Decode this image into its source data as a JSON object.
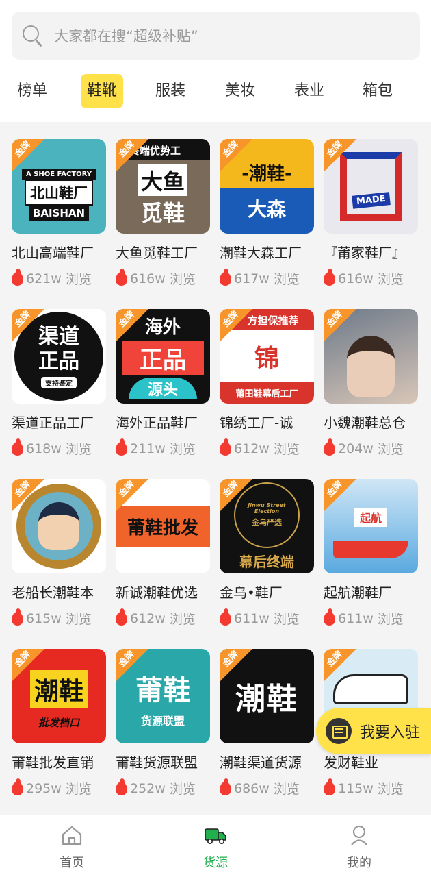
{
  "search": {
    "placeholder": "大家都在搜“超级补贴”"
  },
  "tabs": [
    "榜单",
    "鞋靴",
    "服装",
    "美妆",
    "表业",
    "箱包"
  ],
  "active_tab": "鞋靴",
  "badge_label": "金牌",
  "views_unit": "浏览",
  "items": [
    {
      "name": "北山高端鞋厂",
      "views": "621w",
      "thumb": [
        "A SHOE FACTORY",
        "北山鞋厂",
        "BAISHAN"
      ]
    },
    {
      "name": "大鱼觅鞋工厂",
      "views": "616w",
      "thumb": [
        "终端优势工",
        "大鱼",
        "觅鞋"
      ]
    },
    {
      "name": "潮鞋大森工厂",
      "views": "617w",
      "thumb": [
        "-潮鞋-",
        "大森"
      ]
    },
    {
      "name": "『莆家鞋厂』",
      "views": "616w",
      "thumb": [
        "MADE"
      ]
    },
    {
      "name": "渠道正品工厂",
      "views": "618w",
      "thumb": [
        "渠道",
        "正品",
        "支持鉴定"
      ]
    },
    {
      "name": "海外正品鞋厂",
      "views": "211w",
      "thumb": [
        "海外",
        "正品",
        "源头"
      ]
    },
    {
      "name": "锦绣工厂-诚",
      "views": "612w",
      "thumb": [
        "方担保推荐",
        "锦",
        "莆田鞋幕后工厂"
      ]
    },
    {
      "name": "小魏潮鞋总仓",
      "views": "204w",
      "thumb": []
    },
    {
      "name": "老船长潮鞋本",
      "views": "615w",
      "thumb": []
    },
    {
      "name": "新诚潮鞋优选",
      "views": "612w",
      "thumb": [
        "莆鞋批发"
      ]
    },
    {
      "name": "金乌•鞋厂",
      "views": "611w",
      "thumb": [
        "Jinwu Street Election",
        "金乌严选",
        "幕后终端"
      ]
    },
    {
      "name": "起航潮鞋厂",
      "views": "611w",
      "thumb": [
        "起航"
      ]
    },
    {
      "name": "莆鞋批发直销",
      "views": "295w",
      "thumb": [
        "潮鞋",
        "批发档口"
      ]
    },
    {
      "name": "莆鞋货源联盟",
      "views": "252w",
      "thumb": [
        "莆鞋",
        "货源联盟"
      ]
    },
    {
      "name": "潮鞋渠道货源",
      "views": "686w",
      "thumb": [
        "潮鞋"
      ]
    },
    {
      "name": "发财鞋业",
      "views": "115w",
      "thumb": []
    }
  ],
  "float_button": {
    "label": "我要入驻"
  },
  "bottom_nav": [
    {
      "label": "首页",
      "icon": "home-icon"
    },
    {
      "label": "货源",
      "icon": "truck-icon"
    },
    {
      "label": "我的",
      "icon": "user-icon"
    }
  ],
  "colors": {
    "accent": "#ffe14a",
    "active_nav": "#22b04f",
    "fire": "#f23a30",
    "badge": "#f7952a"
  }
}
